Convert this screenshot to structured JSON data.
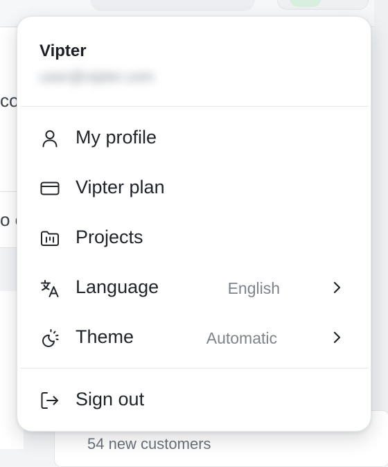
{
  "background": {
    "left_fragment_1": "co",
    "left_fragment_2": "o c",
    "bottom_card_text": "54 new customers"
  },
  "menu": {
    "user": {
      "name": "Vipter",
      "email": "user@vipter.com"
    },
    "items": [
      {
        "label": "My profile",
        "icon": "user-icon"
      },
      {
        "label": "Vipter plan",
        "icon": "credit-card-icon"
      },
      {
        "label": "Projects",
        "icon": "folder-kanban-icon"
      },
      {
        "label": "Language",
        "icon": "language-icon",
        "value": "English",
        "submenu": true
      },
      {
        "label": "Theme",
        "icon": "theme-icon",
        "value": "Automatic",
        "submenu": true
      }
    ],
    "sign_out": {
      "label": "Sign out",
      "icon": "sign-out-icon"
    }
  },
  "colors": {
    "menu_background": "#ffffff",
    "text_primary": "#1f2328",
    "text_secondary": "#7d838a",
    "divider": "#e4e6ea"
  }
}
